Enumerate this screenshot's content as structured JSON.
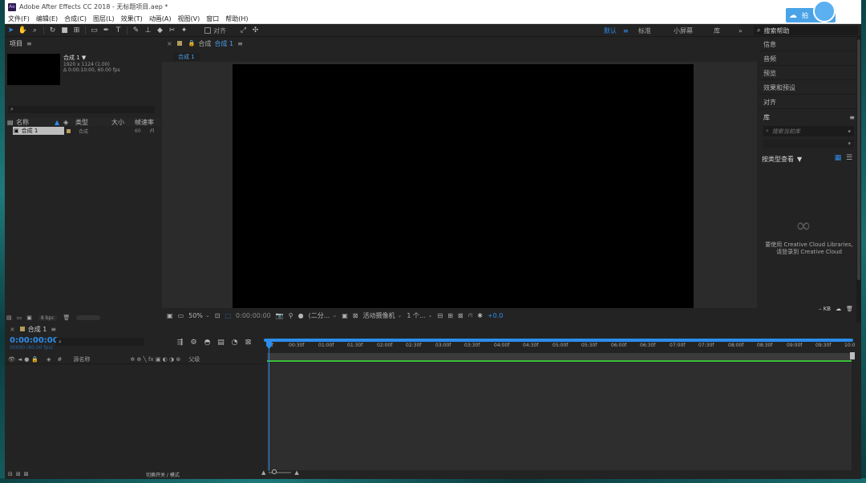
{
  "window": {
    "title": "Adobe After Effects CC 2018 - 无标题项目.aep *",
    "app_icon": "Ae",
    "cloud_button_label": "拍"
  },
  "menu": [
    "文件(F)",
    "编辑(E)",
    "合成(C)",
    "图层(L)",
    "效果(T)",
    "动画(A)",
    "视图(V)",
    "窗口",
    "帮助(H)"
  ],
  "toolbar": {
    "align_label": "对齐",
    "workspaces": [
      {
        "label": "默认",
        "active": true
      },
      {
        "label": "≡",
        "active": true
      },
      {
        "label": "标准",
        "active": false
      },
      {
        "label": "小屏幕",
        "active": false
      },
      {
        "label": "库",
        "active": false
      },
      {
        "label": "»",
        "active": false
      }
    ],
    "search_help": "搜索帮助"
  },
  "project": {
    "title": "项目",
    "comp_name": "合成 1",
    "comp_res": "1920 x 1124 (1.00)",
    "comp_dur": "Δ 0:00:10:00, 60.00 fps",
    "search_placeholder": "",
    "columns": [
      "名称",
      "类型",
      "大小",
      "帧速率"
    ],
    "rows": [
      {
        "name": "合成 1",
        "type": "合成",
        "fps": "60"
      }
    ],
    "bpc": "8 bpc"
  },
  "viewer": {
    "tab_label": "合成",
    "tab_name": "合成 1",
    "sub_tab": "合成 1",
    "zoom": "50%",
    "time": "0:00:00:00",
    "resolution": "(二分...",
    "camera": "活动摄像机",
    "views": "1 个...",
    "exposure": "+0.0"
  },
  "right_panels": {
    "items": [
      "信息",
      "音频",
      "预览",
      "效果和预设",
      "对齐"
    ],
    "library_title": "库",
    "library_search_placeholder": "搜索当前库",
    "view_by": "按类型查看",
    "cc_message_1": "要使用 Creative Cloud Libraries,",
    "cc_message_2": "请登录到 Creative Cloud",
    "size_label": "– KB"
  },
  "timeline": {
    "tab_name": "合成 1",
    "timecode": "0:00:00:00",
    "frames": "00000 (60.00 fps)",
    "layer_columns": [
      "#",
      "源名称",
      "父级"
    ],
    "ruler_ticks": [
      "0f",
      "00:30f",
      "01:00f",
      "01:30f",
      "02:00f",
      "02:30f",
      "03:00f",
      "03:30f",
      "04:00f",
      "04:30f",
      "05:00f",
      "05:30f",
      "06:00f",
      "06:30f",
      "07:00f",
      "07:30f",
      "08:00f",
      "08:30f",
      "09:00f",
      "09:30f",
      "10:0"
    ],
    "toggle_label": "切换开关 / 模式"
  }
}
